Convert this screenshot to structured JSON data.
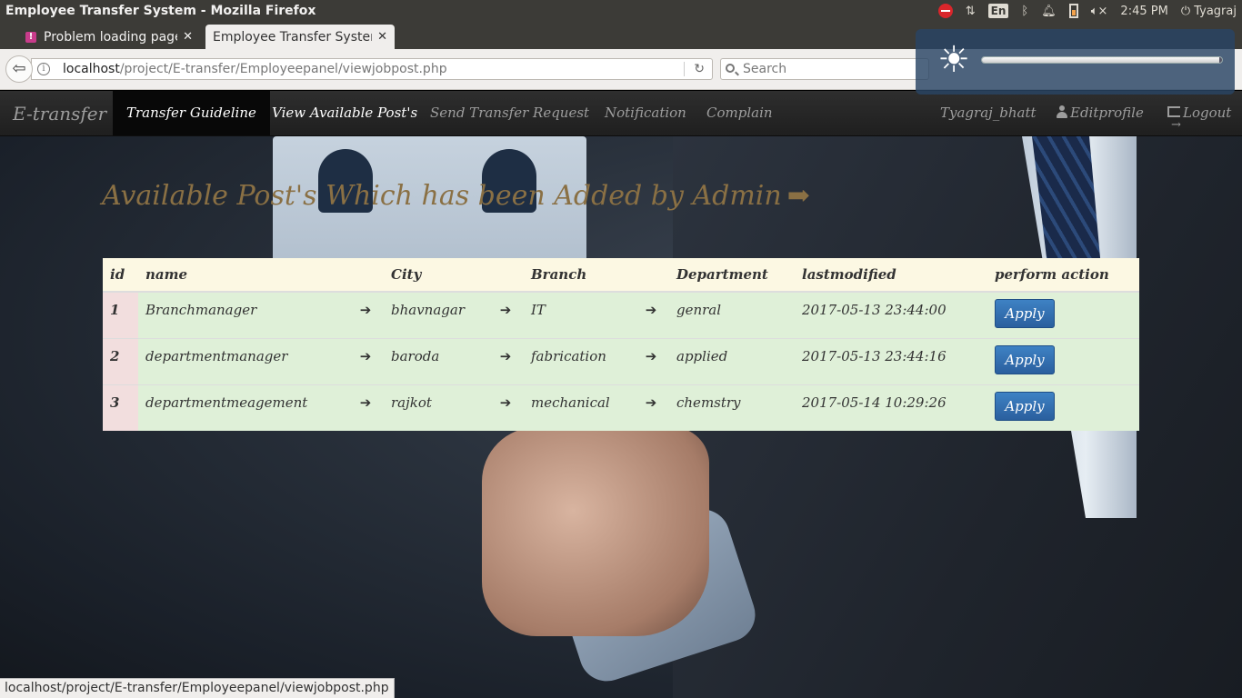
{
  "os": {
    "window_title": "Employee Transfer System - Mozilla Firefox",
    "time": "2:45 PM",
    "user": "Tyagraj",
    "lang": "En"
  },
  "browser": {
    "tabs": [
      {
        "label": "Problem loading page",
        "icon": "warning-icon"
      },
      {
        "label": "Employee Transfer System",
        "icon": ""
      }
    ],
    "url_host": "localhost",
    "url_path": "/project/E-transfer/Employeepanel/viewjobpost.php",
    "search_placeholder": "Search",
    "brightness_level": 0.99,
    "status_url": "localhost/project/E-transfer/Employeepanel/viewjobpost.php"
  },
  "nav": {
    "brand": "E-transfer",
    "items": [
      {
        "label": "Transfer Guideline",
        "state": "active"
      },
      {
        "label": "View Available Post's",
        "state": "bright"
      },
      {
        "label": "Send Transfer Request",
        "state": ""
      },
      {
        "label": "Notification",
        "state": ""
      },
      {
        "label": "Complain",
        "state": ""
      }
    ],
    "username": "Tyagraj_bhatt",
    "editprofile": "Editprofile",
    "logout": "Logout"
  },
  "main": {
    "heading": "Available Post's Which has been Added by Admin",
    "table": {
      "headers": [
        "id",
        "name",
        "City",
        "Branch",
        "Department",
        "lastmodified",
        "perform action"
      ],
      "arrow": "➔",
      "rows": [
        {
          "id": "1",
          "name": "Branchmanager",
          "city": "bhavnagar",
          "branch": "IT",
          "department": "genral",
          "lastmodified": "2017-05-13 23:44:00",
          "action": "Apply"
        },
        {
          "id": "2",
          "name": "departmentmanager",
          "city": "baroda",
          "branch": "fabrication",
          "department": "applied",
          "lastmodified": "2017-05-13 23:44:16",
          "action": "Apply"
        },
        {
          "id": "3",
          "name": "departmentmeagement",
          "city": "rajkot",
          "branch": "mechanical",
          "department": "chemstry",
          "lastmodified": "2017-05-14 10:29:26",
          "action": "Apply"
        }
      ]
    }
  },
  "colors": {
    "heading": "#8a7044",
    "header_row": "#fcf8e3",
    "success_row": "#dff0d8",
    "danger_cell": "#f2dede",
    "button": "#337ab7"
  }
}
